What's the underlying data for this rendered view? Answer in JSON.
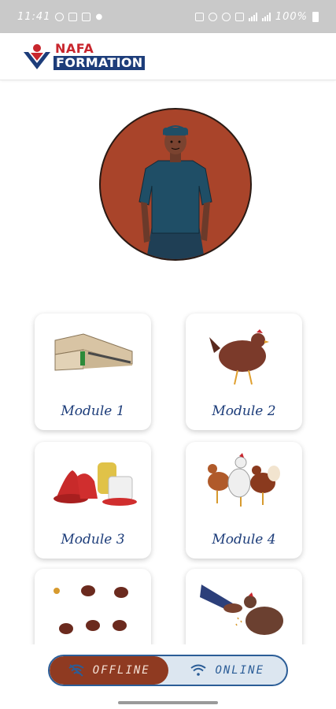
{
  "status_bar": {
    "time": "11:41",
    "battery": "100%"
  },
  "app": {
    "logo_top": "NAFA",
    "logo_bottom": "FORMATION"
  },
  "modules": [
    {
      "label": "Module 1",
      "icon": "poultry-house-icon"
    },
    {
      "label": "Module 2",
      "icon": "hen-icon"
    },
    {
      "label": "Module 3",
      "icon": "feeders-drinkers-icon"
    },
    {
      "label": "Module 4",
      "icon": "chicken-breeds-icon"
    },
    {
      "label": "",
      "icon": "chicks-flock-icon"
    },
    {
      "label": "",
      "icon": "hand-feeding-hen-icon"
    }
  ],
  "mode_toggle": {
    "offline_label": "OFFLINE",
    "online_label": "ONLINE",
    "selected": "offline"
  },
  "colors": {
    "brand_blue": "#1d3d7a",
    "brand_red": "#c8262d",
    "avatar_bg": "#a9442a",
    "offline_active": "#8f3a21",
    "online_bg": "#dce6f0"
  }
}
